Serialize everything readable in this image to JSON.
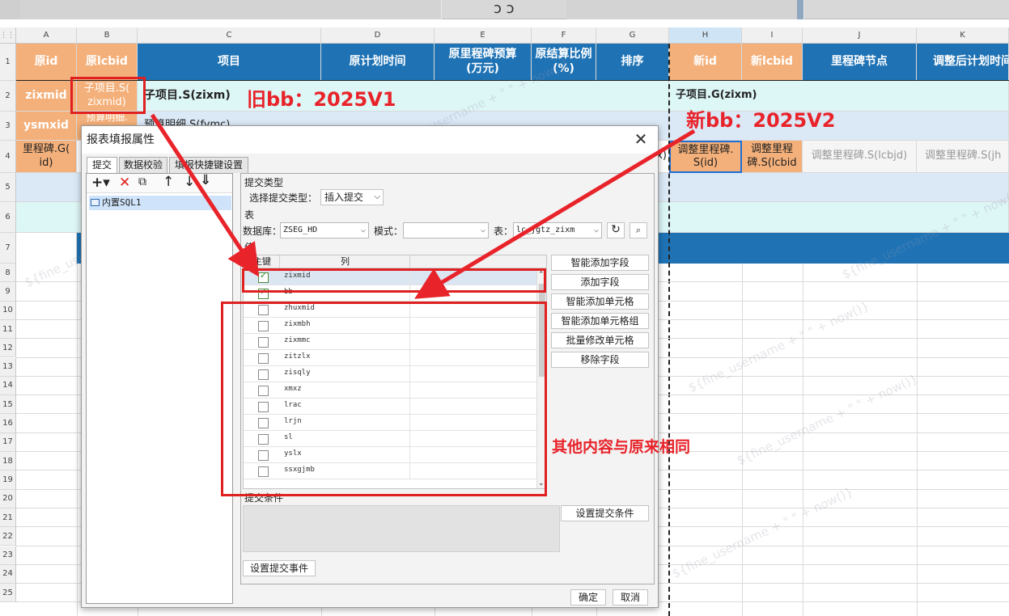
{
  "columns": {
    "letters": [
      "A",
      "B",
      "C",
      "D",
      "E",
      "F",
      "G",
      "H",
      "I",
      "J",
      "K"
    ],
    "row_numbers": [
      "1",
      "2",
      "3",
      "4",
      "5",
      "6",
      "7",
      "8",
      "9",
      "10",
      "11",
      "12",
      "13",
      "14",
      "15",
      "16",
      "17",
      "18",
      "19",
      "20",
      "21",
      "22",
      "23",
      "24",
      "25"
    ]
  },
  "header_row": {
    "A": "原id",
    "B": "原lcbid",
    "C": "项目",
    "D": "原计划时间",
    "E": "原里程碑预算\n(万元)",
    "F": "原结算比例\n(%)",
    "G": "排序",
    "H": "新id",
    "I": "新lcbid",
    "J": "里程碑节点",
    "K": "调整后计划时间"
  },
  "rows": {
    "r2_a": "zixmid",
    "r2_b": "子项目.S(\nzixmid)",
    "r2_c": "子项目.S(zixm)",
    "r2_h": "子项目.G(zixm)",
    "r3_a": "ysmxid",
    "r3_b": "预算明细.",
    "r3_c": "预算明细.S(fymc)",
    "r4_a": "里程碑.G(\nid)",
    "r4_g": "x)",
    "r4_h": "调整里程碑.\nS(id)",
    "r4_i": "调整里程\n碑.S(lcbid",
    "r4_j": "调整里程碑.S(lcbjd)",
    "r4_k": "调整里程碑.S(jh"
  },
  "annotations": {
    "old_bb": "旧bb：2025V1",
    "new_bb": "新bb：2025V2",
    "others_same": "其他内容与原来相同"
  },
  "watermark": "${fine_username + \"  \" + now()}",
  "dialog": {
    "title": "报表填报属性",
    "tabs": [
      "提交",
      "数据校验",
      "填报快捷键设置"
    ],
    "tree_item": "内置SQL1",
    "submit_type_group": "提交类型",
    "submit_type_label": "选择提交类型：",
    "submit_type_value": "插入提交",
    "table_group": "表",
    "database_label": "数据库：",
    "database_value": "ZSEG_HD",
    "mode_label": "模式：",
    "mode_value": "",
    "table_label": "表：",
    "table_value": "lc_jgtz_zixm",
    "value_group": "值",
    "col_key": "主键",
    "col_column": "列",
    "fields": [
      {
        "name": "zixmid",
        "key": true
      },
      {
        "name": "bb",
        "key": true
      },
      {
        "name": "zhuxmid",
        "key": false
      },
      {
        "name": "zixmbh",
        "key": false
      },
      {
        "name": "zixmmc",
        "key": false
      },
      {
        "name": "zitzlx",
        "key": false
      },
      {
        "name": "zisqly",
        "key": false
      },
      {
        "name": "xmxz",
        "key": false
      },
      {
        "name": "lrac",
        "key": false
      },
      {
        "name": "lrjn",
        "key": false
      },
      {
        "name": "sl",
        "key": false
      },
      {
        "name": "yslx",
        "key": false
      },
      {
        "name": "ssxgjmb",
        "key": false
      }
    ],
    "side_buttons": [
      "智能添加字段",
      "添加字段",
      "智能添加单元格",
      "智能添加单元格组",
      "批量修改单元格",
      "移除字段"
    ],
    "condition_group": "提交条件",
    "set_condition": "设置提交条件",
    "set_event": "设置提交事件",
    "ok": "确定",
    "cancel": "取消"
  }
}
